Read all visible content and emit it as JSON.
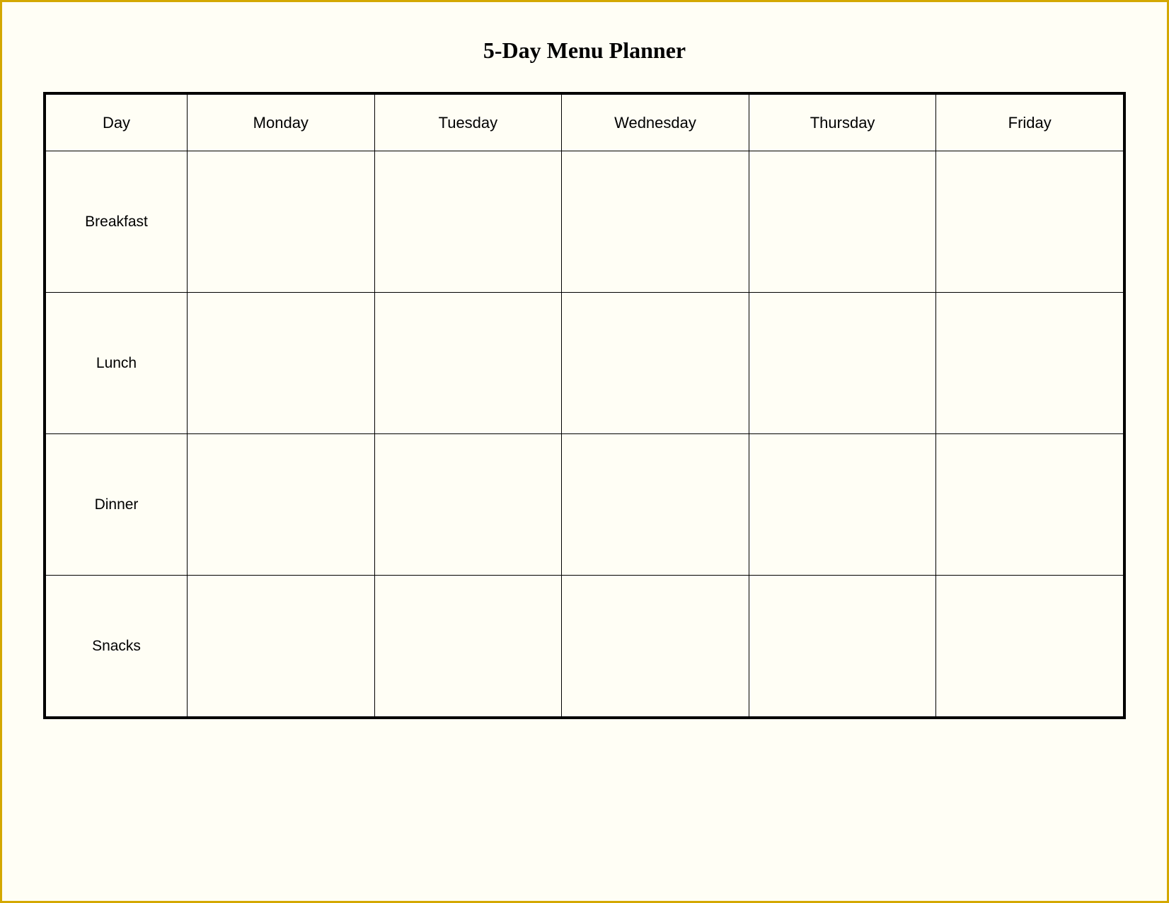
{
  "title": "5-Day Menu Planner",
  "columns": {
    "day": "Day",
    "monday": "Monday",
    "tuesday": "Tuesday",
    "wednesday": "Wednesday",
    "thursday": "Thursday",
    "friday": "Friday"
  },
  "rows": [
    {
      "label": "Breakfast"
    },
    {
      "label": "Lunch"
    },
    {
      "label": "Dinner"
    },
    {
      "label": "Snacks"
    }
  ]
}
